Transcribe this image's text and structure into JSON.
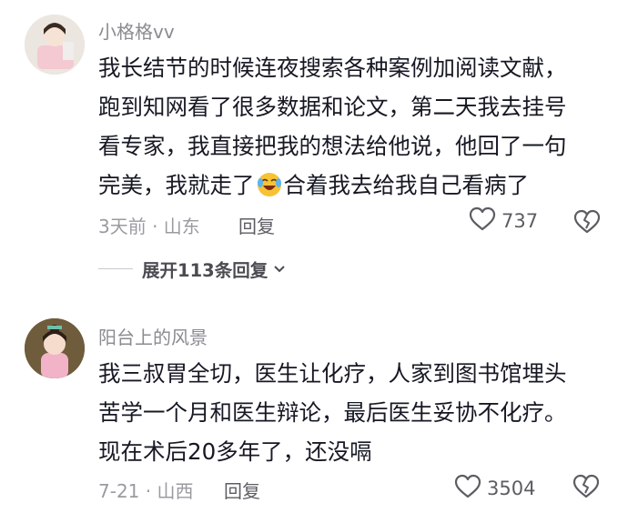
{
  "comments": [
    {
      "username": "小格格vv",
      "content_lines": [
        "我长结节的时候连夜搜索各种案例加阅读文献，",
        "跑到知网看了很多数据和论文，第二天我去挂号",
        "看专家，我直接把我的想法给他说，他回了一句",
        "完美，我就走了"
      ],
      "content_tail": "合着我去给我自己看病了",
      "emoji": "laughing-tears-emoji",
      "meta": "3天前 · 山东",
      "reply_label": "回复",
      "like_count": "737",
      "expand_label": "展开113条回复"
    },
    {
      "username": "阳台上的风景",
      "content_lines": [
        "我三叔胃全切，医生让化疗，人家到图书馆埋头",
        "苦学一个月和医生辩论，最后医生妥协不化疗。",
        "现在术后20多年了，还没嗝"
      ],
      "meta": "7-21 · 山西",
      "reply_label": "回复",
      "like_count": "3504"
    }
  ],
  "colors": {
    "text": "#161823",
    "secondary": "#8a8b91",
    "action": "#5c5d63"
  }
}
